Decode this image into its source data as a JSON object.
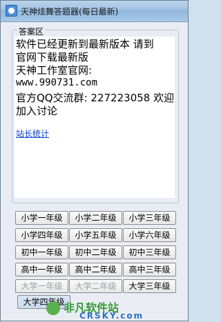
{
  "window": {
    "title": "天神炫舞答题器(每日最新)"
  },
  "answer_area": {
    "label": "答案区",
    "lines": [
      "软件已经更新到最新版本 请到",
      "官网下载最新版",
      "天神工作室官网:",
      "www.990731.com",
      "官方QQ交流群: 227223058 欢迎",
      "加入讨论"
    ],
    "link_text": "站长统计"
  },
  "buttons": [
    {
      "label": "小学一年级",
      "enabled": true
    },
    {
      "label": "小学二年级",
      "enabled": true
    },
    {
      "label": "小学三年级",
      "enabled": true
    },
    {
      "label": "小学四年级",
      "enabled": true
    },
    {
      "label": "小学五年级",
      "enabled": true
    },
    {
      "label": "小学六年级",
      "enabled": true
    },
    {
      "label": "初中一年级",
      "enabled": true
    },
    {
      "label": "初中二年级",
      "enabled": true
    },
    {
      "label": "初中三年级",
      "enabled": true
    },
    {
      "label": "高中一年级",
      "enabled": true
    },
    {
      "label": "高中二年级",
      "enabled": true
    },
    {
      "label": "高中三年级",
      "enabled": true
    },
    {
      "label": "大学一年级",
      "enabled": false
    },
    {
      "label": "大学二年级",
      "enabled": false
    },
    {
      "label": "大学三年级",
      "enabled": true
    },
    {
      "label": "大学四年级",
      "enabled": true
    }
  ],
  "watermark": {
    "text_cn": "非凡软件站",
    "text_en": "CRSKY.com"
  }
}
